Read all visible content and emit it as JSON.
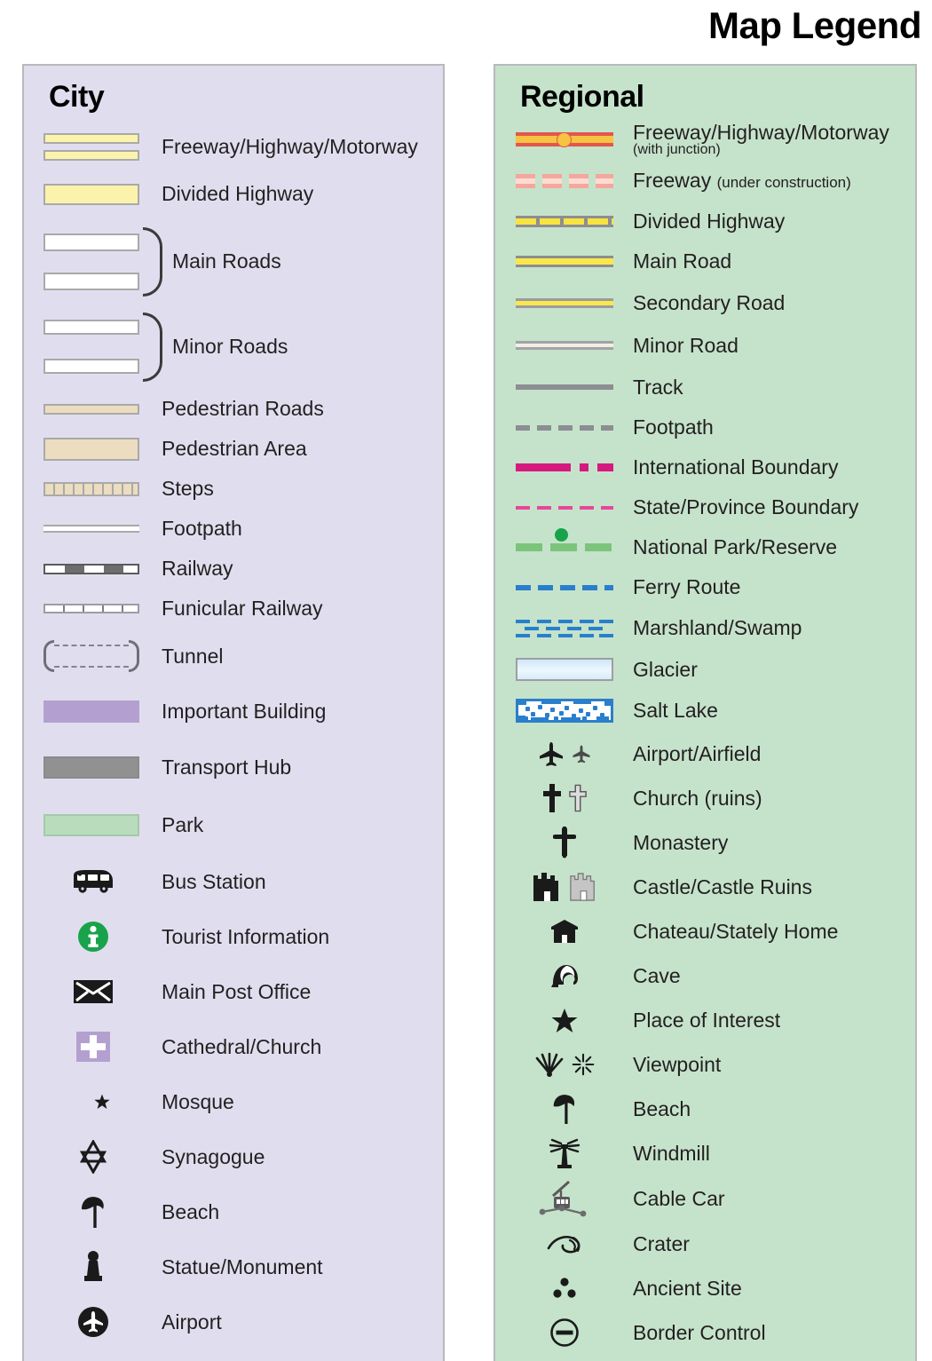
{
  "title": "Map Legend",
  "city": {
    "heading": "City",
    "items": [
      {
        "label": "Freeway/Highway/Motorway",
        "symbol": "freeway-double-bar"
      },
      {
        "label": "Divided Highway",
        "symbol": "divided-highway-bar"
      },
      {
        "label": "Main Roads",
        "symbol": "white-bars-braced"
      },
      {
        "label": "Minor Roads",
        "symbol": "white-thin-bars-braced"
      },
      {
        "label": "Pedestrian Roads",
        "symbol": "pedestrian-road-bar"
      },
      {
        "label": "Pedestrian Area",
        "symbol": "pedestrian-area-bar"
      },
      {
        "label": "Steps",
        "symbol": "steps-bar"
      },
      {
        "label": "Footpath",
        "symbol": "footpath-line"
      },
      {
        "label": "Railway",
        "symbol": "railway-line"
      },
      {
        "label": "Funicular Railway",
        "symbol": "funicular-line"
      },
      {
        "label": "Tunnel",
        "symbol": "tunnel-bracket"
      },
      {
        "label": "Important Building",
        "symbol": "important-building-swatch"
      },
      {
        "label": "Transport Hub",
        "symbol": "transport-hub-swatch"
      },
      {
        "label": "Park",
        "symbol": "park-swatch"
      },
      {
        "label": "Bus Station",
        "symbol": "bus-icon"
      },
      {
        "label": "Tourist Information",
        "symbol": "information-icon"
      },
      {
        "label": "Main Post Office",
        "symbol": "envelope-icon"
      },
      {
        "label": "Cathedral/Church",
        "symbol": "cross-square-icon"
      },
      {
        "label": "Mosque",
        "symbol": "star-crescent-icon"
      },
      {
        "label": "Synagogue",
        "symbol": "star-of-david-icon"
      },
      {
        "label": "Beach",
        "symbol": "beach-umbrella-icon"
      },
      {
        "label": "Statue/Monument",
        "symbol": "statue-icon"
      },
      {
        "label": "Airport",
        "symbol": "airport-circle-icon"
      }
    ]
  },
  "regional": {
    "heading": "Regional",
    "items": [
      {
        "label": "Freeway/Highway/Motorway",
        "sublabel": "(with junction)",
        "symbol": "freeway-junction-line"
      },
      {
        "label": "Freeway",
        "sublabel_inline": "(under construction)",
        "symbol": "freeway-construction-line"
      },
      {
        "label": "Divided Highway",
        "symbol": "divided-highway-line"
      },
      {
        "label": "Main Road",
        "symbol": "main-road-line"
      },
      {
        "label": "Secondary Road",
        "symbol": "secondary-road-line"
      },
      {
        "label": "Minor Road",
        "symbol": "minor-road-line"
      },
      {
        "label": "Track",
        "symbol": "track-line"
      },
      {
        "label": "Footpath",
        "symbol": "footpath-dashed-line"
      },
      {
        "label": "International Boundary",
        "symbol": "international-boundary-line"
      },
      {
        "label": "State/Province Boundary",
        "symbol": "state-boundary-line"
      },
      {
        "label": "National Park/Reserve",
        "symbol": "national-park-line"
      },
      {
        "label": "Ferry Route",
        "symbol": "ferry-route-line"
      },
      {
        "label": "Marshland/Swamp",
        "symbol": "marshland-pattern"
      },
      {
        "label": "Glacier",
        "symbol": "glacier-swatch"
      },
      {
        "label": "Salt Lake",
        "symbol": "salt-lake-swatch"
      },
      {
        "label": "Airport/Airfield",
        "symbol": "airplane-icons"
      },
      {
        "label": "Church (ruins)",
        "symbol": "church-cross-icons"
      },
      {
        "label": "Monastery",
        "symbol": "monastery-cross-icon"
      },
      {
        "label": "Castle/Castle Ruins",
        "symbol": "castle-icons"
      },
      {
        "label": "Chateau/Stately Home",
        "symbol": "chateau-icon"
      },
      {
        "label": "Cave",
        "symbol": "cave-icon"
      },
      {
        "label": "Place of Interest",
        "symbol": "star-icon"
      },
      {
        "label": "Viewpoint",
        "symbol": "viewpoint-icons"
      },
      {
        "label": "Beach",
        "symbol": "beach-umbrella-icon"
      },
      {
        "label": "Windmill",
        "symbol": "windmill-icon"
      },
      {
        "label": "Cable Car",
        "symbol": "cable-car-icon"
      },
      {
        "label": "Crater",
        "symbol": "crater-icon"
      },
      {
        "label": "Ancient Site",
        "symbol": "ancient-site-icon"
      },
      {
        "label": "Border Control",
        "symbol": "border-control-icon"
      }
    ]
  },
  "colors": {
    "city_panel_bg": "#e0deee",
    "regional_panel_bg": "#c5e3cb",
    "panel_border": "#b9b9bd",
    "highway_yellow": "#fbf3ac",
    "pedestrian_tan": "#ecdcc0",
    "important_building_purple": "#b4a0d0",
    "transport_hub_gray": "#919191",
    "park_green": "#b9ddbc",
    "info_green": "#18a34a",
    "freeway_red": "#e2574c",
    "freeway_yellow": "#f7c343",
    "road_yellow": "#f9e84a",
    "boundary_magenta": "#d6197f",
    "state_boundary_pink": "#e8479b",
    "park_line_green": "#7cc47b",
    "ferry_blue": "#2a7fcc",
    "glacier_blue": "#cfe6f7",
    "text": "#231f20"
  }
}
